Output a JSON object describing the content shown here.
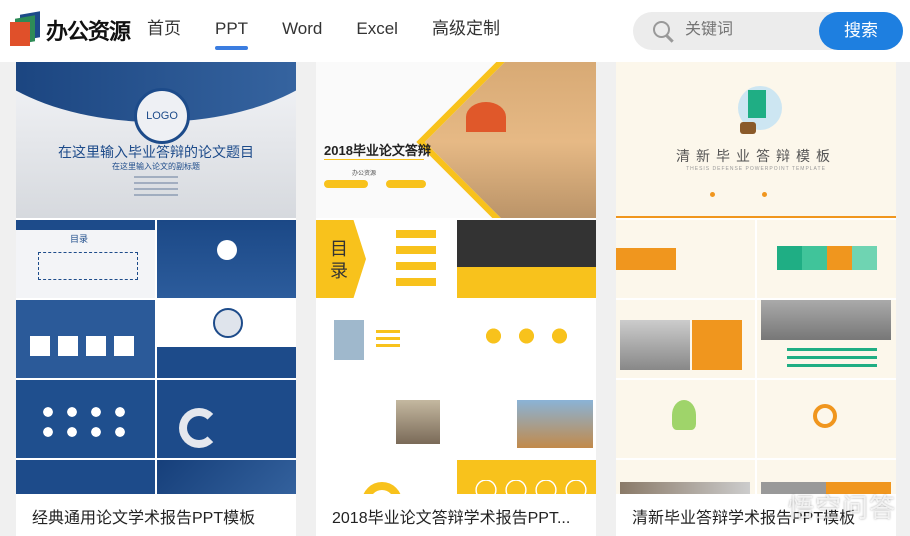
{
  "header": {
    "logo_text": "办公资源",
    "nav": [
      {
        "label": "首页",
        "active": false
      },
      {
        "label": "PPT",
        "active": true
      },
      {
        "label": "Word",
        "active": false
      },
      {
        "label": "Excel",
        "active": false
      },
      {
        "label": "高级定制",
        "active": false
      }
    ],
    "search": {
      "placeholder": "关键词",
      "button": "搜索"
    },
    "accent": "#1e7fe0"
  },
  "cards": [
    {
      "title": "经典通用论文学术报告PPT模板",
      "cover": {
        "logo": "LOGO",
        "heading": "在这里输入毕业答辩的论文题目",
        "subheading": "在这里输入论文的副标题"
      },
      "slide_label": "目录",
      "theme": "#1d4b8a"
    },
    {
      "title": "2018毕业论文答辩学术报告PPT...",
      "cover": {
        "heading": "2018毕业论文答辩",
        "org": "办公资源"
      },
      "slide_label": "目录",
      "theme": "#f8c21c"
    },
    {
      "title": "清新毕业答辩学术报告PPT模板",
      "cover": {
        "heading": "清新毕业答辩模板",
        "subheading": "THESIS DEFENSE POWERPOINT TEMPLATE"
      },
      "theme": "#f0961e"
    }
  ],
  "watermark": "悟空问答"
}
